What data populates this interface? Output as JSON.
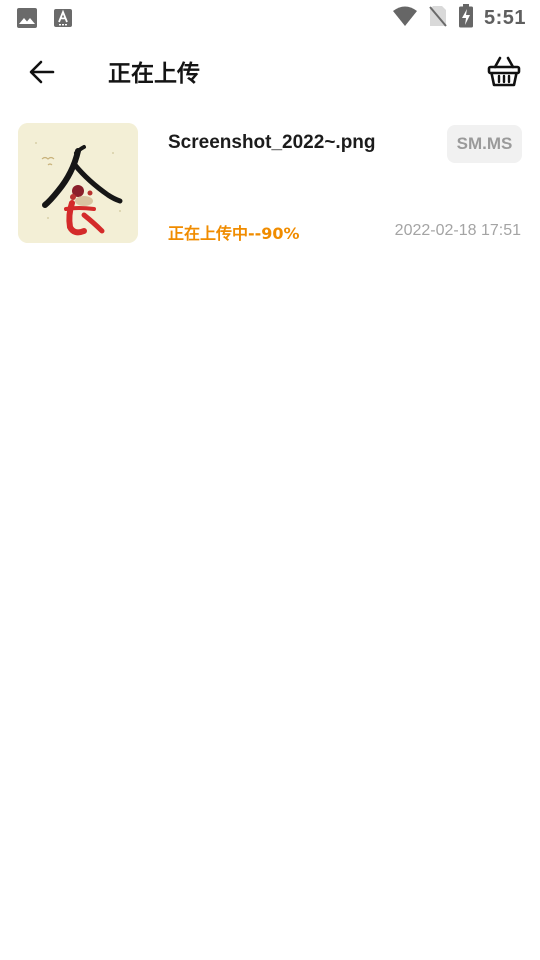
{
  "status_bar": {
    "time": "5:51",
    "left_icons": [
      "image-icon",
      "text-a-icon"
    ],
    "right_icons": [
      "wifi-icon",
      "no-sim-icon",
      "battery-charging-icon"
    ]
  },
  "toolbar": {
    "title": "正在上传",
    "back_icon": "arrow-left-icon",
    "action_icon": "basket-icon"
  },
  "upload": {
    "file_name": "Screenshot_2022~.png",
    "host": "SM.MS",
    "status_text": "正在上传中--90%",
    "progress_percent": 90,
    "timestamp": "2022-02-18 17:51"
  },
  "colors": {
    "accent_orange": "#f08c00",
    "muted_gray": "#a4a4a4",
    "badge_bg": "#f1f1f1"
  }
}
